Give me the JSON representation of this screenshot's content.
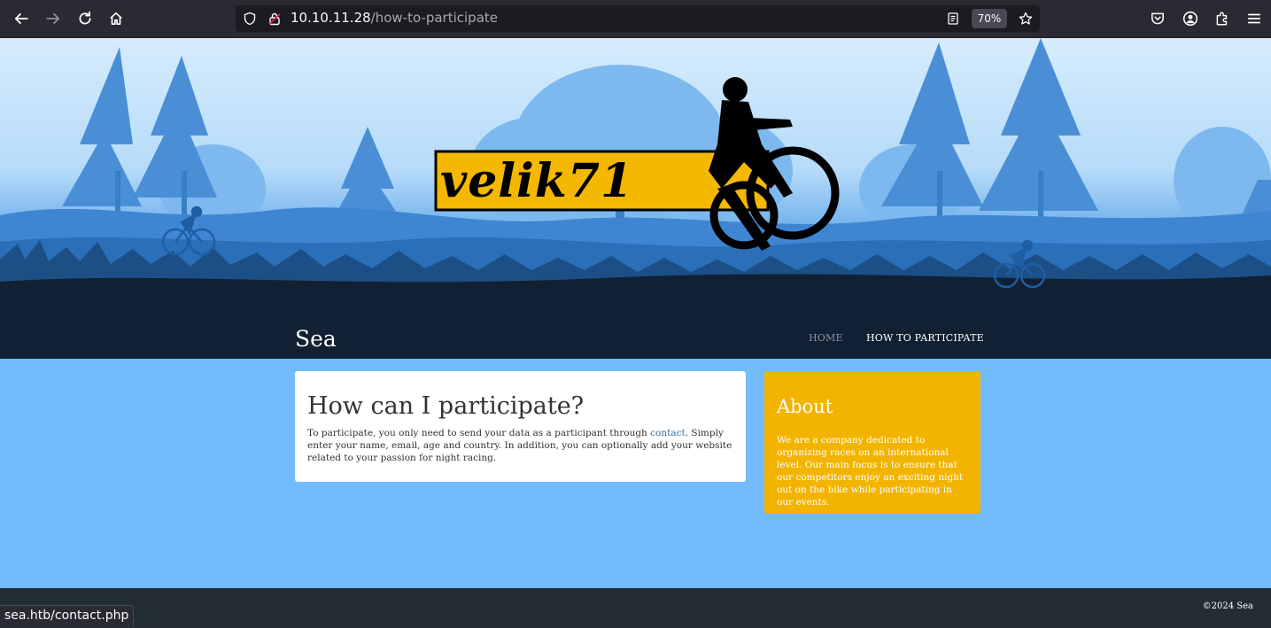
{
  "browser": {
    "url_host": "10.10.11.28",
    "url_path": "/how-to-participate",
    "zoom": "70%",
    "icons": [
      "back-icon",
      "forward-icon",
      "reload-icon",
      "home-icon",
      "shield-icon",
      "lock-icon",
      "reader-view-icon",
      "star-icon",
      "pocket-icon",
      "account-icon",
      "extensions-icon",
      "menu-icon"
    ]
  },
  "header": {
    "logo_text": "velik71",
    "site_title": "Sea",
    "nav": [
      {
        "label": "HOME"
      },
      {
        "label": "HOW TO PARTICIPATE"
      }
    ]
  },
  "main": {
    "title": "How can I participate?",
    "text_before": "To participate, you only need to send your data as a participant through ",
    "link_label": "contact",
    "text_after": ". Simply enter your name, email, age and country. In addition, you can optionally add your website related to your passion for night racing."
  },
  "sidebar": {
    "title": "About",
    "text": "We are a company dedicated to organizing races on an international level. Our main focus is to ensure that our competitors enjoy an exciting night out on the bike while participating in our events."
  },
  "footer": {
    "copyright": "©2024 Sea"
  },
  "status_bar": {
    "text": "sea.htb/contact.php"
  },
  "colors": {
    "content_bg": "#73bcfb",
    "about_bg": "#f2b400",
    "hero_dark": "#112033",
    "logo_yellow": "#f5b800"
  }
}
